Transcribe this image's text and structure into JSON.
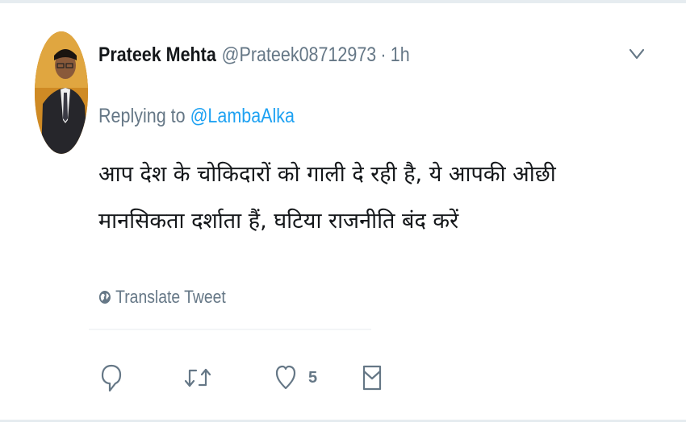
{
  "tweet": {
    "author_name": "Prateek Mehta",
    "author_handle": "@Prateek08712973",
    "separator": "·",
    "time": "1h",
    "replying_prefix": "Replying to",
    "replying_to": "@LambaAlka",
    "text": "आप देश के चोकिदारों को गाली दे रही है, ये आपकी ओछी मानसिकता दर्शाता हैं, घटिया राजनीति बंद करें",
    "translate_label": "Translate Tweet"
  },
  "actions": {
    "like_count": "5"
  },
  "icons": {
    "caret": "chevron-down-icon",
    "translate": "globe-icon",
    "reply": "reply-icon",
    "retweet": "retweet-icon",
    "like": "heart-icon",
    "message": "direct-message-icon"
  },
  "colors": {
    "link": "#1da1f2",
    "secondary_text": "#657786",
    "primary_text": "#14171a",
    "divider": "#e6ecf0"
  }
}
